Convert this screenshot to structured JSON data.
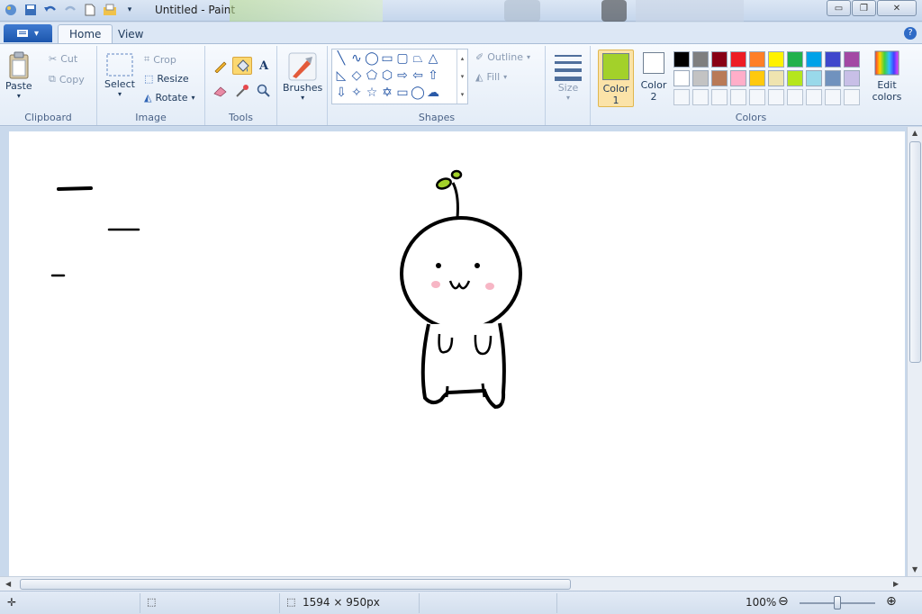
{
  "window": {
    "title": "Untitled - Paint"
  },
  "menu": {
    "file_button": "▾",
    "tabs": [
      {
        "label": "Home",
        "active": true
      },
      {
        "label": "View",
        "active": false
      }
    ]
  },
  "ribbon": {
    "clipboard": {
      "group_label": "Clipboard",
      "paste": "Paste",
      "cut": "Cut",
      "copy": "Copy"
    },
    "image": {
      "group_label": "Image",
      "select": "Select",
      "crop": "Crop",
      "resize": "Resize",
      "rotate": "Rotate"
    },
    "tools": {
      "group_label": "Tools",
      "selected_tool": "fill-icon"
    },
    "brushes": {
      "label": "Brushes"
    },
    "shapes": {
      "group_label": "Shapes",
      "outline": "Outline",
      "fill": "Fill"
    },
    "size": {
      "label": "Size"
    },
    "colors": {
      "group_label": "Colors",
      "color1_label": "Color",
      "color1_num": "1",
      "color1_value": "#a3d12a",
      "color2_label": "Color",
      "color2_num": "2",
      "color2_value": "#ffffff",
      "edit_label_1": "Edit",
      "edit_label_2": "colors",
      "palette_row1": [
        "#000000",
        "#7f7f7f",
        "#880015",
        "#ed1c24",
        "#ff7f27",
        "#fff200",
        "#22b14c",
        "#00a2e8",
        "#3f48cc",
        "#a349a4"
      ],
      "palette_row2": [
        "#ffffff",
        "#c3c3c3",
        "#b97a57",
        "#ffaec9",
        "#ffc90e",
        "#efe4b0",
        "#b5e61d",
        "#99d9ea",
        "#7092be",
        "#c8bfe7"
      ]
    }
  },
  "status": {
    "canvas_size": "1594 × 950px",
    "zoom": "100%"
  }
}
